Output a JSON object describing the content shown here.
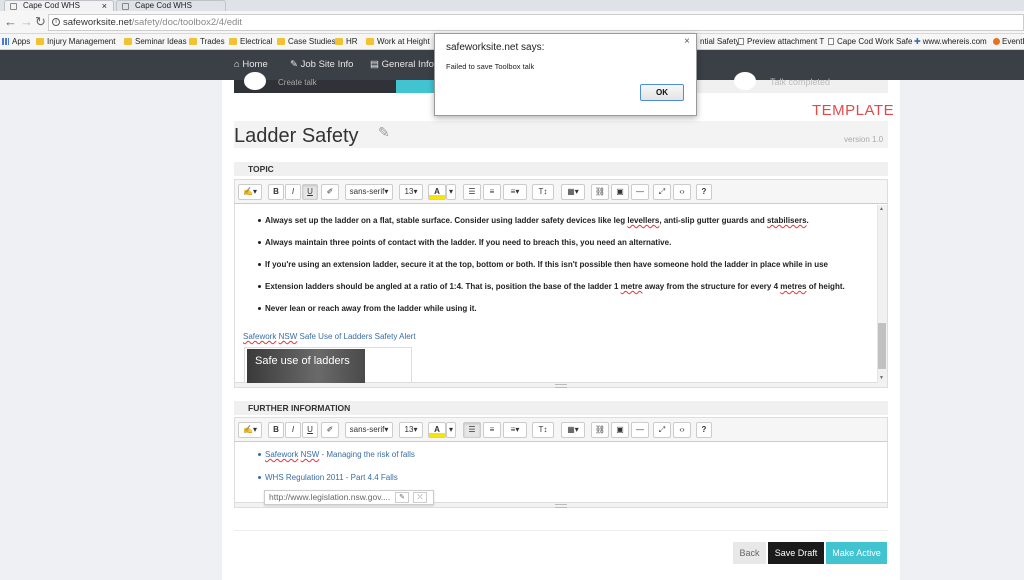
{
  "browser": {
    "tabs": [
      {
        "title": "Cape Cod WHS",
        "close": "×"
      },
      {
        "title": "Cape Cod WHS"
      }
    ],
    "url_host": "safeworksite.net",
    "url_path": "/safety/doc/toolbox2/4/edit",
    "bookmarks": [
      "Apps",
      "Injury Management &",
      "Seminar Ideas",
      "Trades",
      "Electrical",
      "Case Studies",
      "HR",
      "Work at Height",
      "ntial Safety",
      "Preview attachment T",
      "Cape Cod Work Safe",
      "www.whereis.com",
      "EventB"
    ]
  },
  "nav": {
    "items": [
      "Home",
      "Job Site Info",
      "General Info"
    ]
  },
  "steps": {
    "first": "Create talk",
    "last": "Talk completed"
  },
  "page": {
    "template_label": "TEMPLATE",
    "title": "Ladder Safety",
    "version": "version 1.0"
  },
  "topic": {
    "header": "TOPIC",
    "font": "sans-serif",
    "size": "13",
    "bullets": [
      [
        "Always set up the ladder on a flat, stable surface. Consider using ladder safety devices like leg ",
        "levellers",
        ", anti-slip gutter guards and ",
        "stabilisers",
        "."
      ],
      [
        "Always maintain three points of contact with the ladder. If you need to breach this, you need an alternative."
      ],
      [
        "If you're using an extension ladder, secure it at the top, bottom or both. If this isn't possible then have someone hold the ladder in place while in use"
      ],
      [
        "Extension ladders should be angled at a ratio of 1:4. That is, position the base of the ladder 1 ",
        "metre",
        " away from the structure for every 4 ",
        "metres",
        " of height."
      ],
      [
        "Never lean or reach away from the ladder while using it."
      ]
    ],
    "link_parts": [
      "Safework",
      " ",
      "NSW",
      " Safe Use of Ladders Safety Alert"
    ],
    "video_title": "Safe use of ladders"
  },
  "further": {
    "header": "FURTHER INFORMATION",
    "font": "sans-serif",
    "size": "13",
    "link1_parts": [
      "Safework",
      " ",
      "NSW",
      " - Managing the risk of falls"
    ],
    "link2": "WHS Regulation 2011 - Part 4.4 Falls",
    "tooltip_url": "http://www.legislation.nsw.gov...."
  },
  "toolbar": {
    "bold": "B",
    "italic": "I",
    "underline": "U",
    "help": "?"
  },
  "buttons": {
    "back": "Back",
    "save_draft": "Save Draft",
    "make_active": "Make Active"
  },
  "dialog": {
    "title": "safeworksite.net says:",
    "message": "Failed to save Toolbox talk",
    "ok": "OK"
  },
  "colors": {
    "accent": "#41c3d0",
    "template": "#e24a4a",
    "navbar": "#3b4047"
  }
}
